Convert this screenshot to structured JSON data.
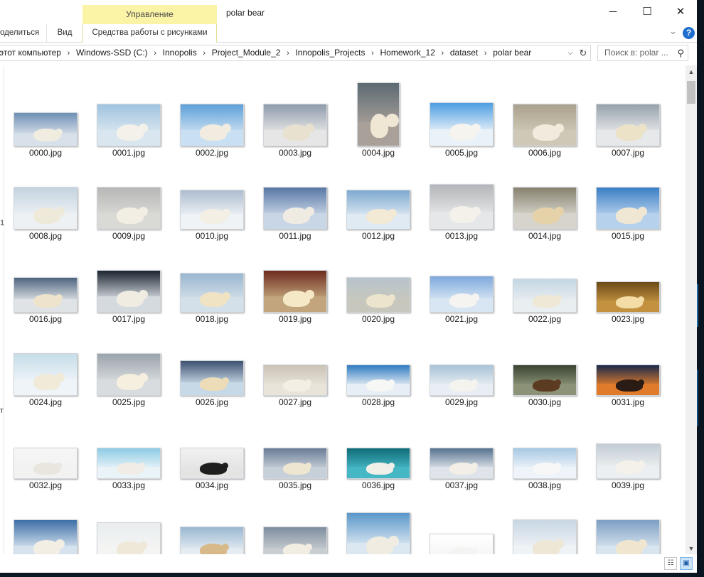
{
  "window": {
    "title": "polar bear",
    "context_tab_group": "Управление",
    "controls": {
      "minimize": "─",
      "maximize": "☐",
      "close": "✕"
    }
  },
  "ribbon": {
    "tabs": [
      {
        "label": "оделиться"
      },
      {
        "label": "Вид"
      },
      {
        "label": "Средства работы с рисунками"
      }
    ],
    "collapse_glyph": "⌄",
    "help_glyph": "?"
  },
  "address": {
    "crumbs": [
      "этот компьютер",
      "Windows-SSD (C:)",
      "Innopolis",
      "Project_Module_2",
      "Innopolis_Projects",
      "Homework_12",
      "dataset",
      "polar bear"
    ],
    "separator": "›",
    "dropdown_glyph": "⌵",
    "refresh_glyph": "↻"
  },
  "search": {
    "placeholder": "Поиск в: polar ...",
    "icon": "search-icon",
    "glyph": "⚲"
  },
  "nav_fragments": [
    "1",
    "т"
  ],
  "files": [
    {
      "name": "0000.jpg",
      "palette": [
        "#6f8fb4",
        "#d8e1ea",
        "#f1ece0"
      ]
    },
    {
      "name": "0001.jpg",
      "palette": [
        "#9fc3df",
        "#d9e6ef",
        "#f4f1ea"
      ]
    },
    {
      "name": "0002.jpg",
      "palette": [
        "#5ea0d8",
        "#c9dff2",
        "#f2ece0"
      ]
    },
    {
      "name": "0003.jpg",
      "palette": [
        "#8e9bab",
        "#e6e6e6",
        "#e8e1d0"
      ]
    },
    {
      "name": "0004.jpg",
      "palette": [
        "#5c6a72",
        "#a9a09a",
        "#efe6d4"
      ]
    },
    {
      "name": "0005.jpg",
      "palette": [
        "#4d9ee2",
        "#e9f2f9",
        "#f6f4ee"
      ]
    },
    {
      "name": "0006.jpg",
      "palette": [
        "#a9a18d",
        "#cfc8b6",
        "#f1ebdd"
      ]
    },
    {
      "name": "0007.jpg",
      "palette": [
        "#97a1ab",
        "#e6e8ea",
        "#ece2c8"
      ]
    },
    {
      "name": "0008.jpg",
      "palette": [
        "#c4d3e0",
        "#edf1f4",
        "#efe9da"
      ]
    },
    {
      "name": "0009.jpg",
      "palette": [
        "#b7b7b5",
        "#d9d9d6",
        "#f2eee4"
      ]
    },
    {
      "name": "0010.jpg",
      "palette": [
        "#aebdd0",
        "#eff3f6",
        "#f3efe4"
      ]
    },
    {
      "name": "0011.jpg",
      "palette": [
        "#5877a6",
        "#c9d6e6",
        "#efebe2"
      ]
    },
    {
      "name": "0012.jpg",
      "palette": [
        "#7ea9cf",
        "#dfeaf3",
        "#f3ead5"
      ]
    },
    {
      "name": "0013.jpg",
      "palette": [
        "#b3b5b8",
        "#e6e7e8",
        "#f4f1ea"
      ]
    },
    {
      "name": "0014.jpg",
      "palette": [
        "#87816d",
        "#d6d4cc",
        "#e6d2a8"
      ]
    },
    {
      "name": "0015.jpg",
      "palette": [
        "#3a7ec6",
        "#b5d1ec",
        "#efe7d4"
      ]
    },
    {
      "name": "0016.jpg",
      "palette": [
        "#4f6580",
        "#dfe3e6",
        "#eee4cc"
      ]
    },
    {
      "name": "0017.jpg",
      "palette": [
        "#1b2430",
        "#d5dadf",
        "#f0ece2"
      ]
    },
    {
      "name": "0018.jpg",
      "palette": [
        "#9ab6cf",
        "#d3dfe9",
        "#efe3c3"
      ]
    },
    {
      "name": "0019.jpg",
      "palette": [
        "#6d2b1f",
        "#c2a57c",
        "#f4e8c6"
      ]
    },
    {
      "name": "0020.jpg",
      "palette": [
        "#b7c4cb",
        "#c8c7bd",
        "#ece4cc"
      ]
    },
    {
      "name": "0021.jpg",
      "palette": [
        "#7ea9dc",
        "#d8e6f4",
        "#f5f4f0"
      ]
    },
    {
      "name": "0022.jpg",
      "palette": [
        "#c4d6e4",
        "#e9eef1",
        "#f0e8d6"
      ]
    },
    {
      "name": "0023.jpg",
      "palette": [
        "#6c4a16",
        "#c29240",
        "#f3dca6"
      ]
    },
    {
      "name": "0024.jpg",
      "palette": [
        "#c7dde9",
        "#eef4f8",
        "#f1ead8"
      ]
    },
    {
      "name": "0025.jpg",
      "palette": [
        "#9aa3ab",
        "#d9dcdf",
        "#f4efdf"
      ]
    },
    {
      "name": "0026.jpg",
      "palette": [
        "#3e5272",
        "#c7d8e6",
        "#ecdcb8"
      ]
    },
    {
      "name": "0027.jpg",
      "palette": [
        "#c9c2b5",
        "#e9e4da",
        "#f4efe5"
      ]
    },
    {
      "name": "0028.jpg",
      "palette": [
        "#2f7bc2",
        "#e7eef5",
        "#f7f7f5"
      ]
    },
    {
      "name": "0029.jpg",
      "palette": [
        "#a9c2d6",
        "#e8eef3",
        "#f5f3ee"
      ]
    },
    {
      "name": "0030.jpg",
      "palette": [
        "#394431",
        "#8b9277",
        "#5b3b22"
      ]
    },
    {
      "name": "0031.jpg",
      "palette": [
        "#1b2a4a",
        "#e07b2b",
        "#2a1c14"
      ]
    },
    {
      "name": "0032.jpg",
      "palette": [
        "#f6f6f6",
        "#f2f2f2",
        "#e9e6df"
      ]
    },
    {
      "name": "0033.jpg",
      "palette": [
        "#8ecbe5",
        "#e9f3f8",
        "#f1ede6"
      ]
    },
    {
      "name": "0034.jpg",
      "palette": [
        "#f1f1f1",
        "#e4e4e4",
        "#1f1f1f"
      ]
    },
    {
      "name": "0035.jpg",
      "palette": [
        "#6a7d96",
        "#c7cfd8",
        "#efe6d2"
      ]
    },
    {
      "name": "0036.jpg",
      "palette": [
        "#0f6b78",
        "#46b7c4",
        "#f0efe8"
      ]
    },
    {
      "name": "0037.jpg",
      "palette": [
        "#55728f",
        "#dfe4ea",
        "#f3efe6"
      ]
    },
    {
      "name": "0038.jpg",
      "palette": [
        "#a7c8e4",
        "#eef4f9",
        "#f7f7f7"
      ]
    },
    {
      "name": "0039.jpg",
      "palette": [
        "#c3ccd4",
        "#eceff1",
        "#f4f1ea"
      ]
    },
    {
      "name": "",
      "palette": [
        "#3d6fa7",
        "#d6e3ef",
        "#f2eee4"
      ]
    },
    {
      "name": "",
      "palette": [
        "#e9edf0",
        "#f4f4f3",
        "#efe8d8"
      ]
    },
    {
      "name": "",
      "palette": [
        "#9ab7d1",
        "#e5edf3",
        "#d8b98a"
      ]
    },
    {
      "name": "",
      "palette": [
        "#7e8e9f",
        "#c9ced2",
        "#f2ede2"
      ]
    },
    {
      "name": "",
      "palette": [
        "#5a96c9",
        "#dbe8f2",
        "#f1ece1"
      ]
    },
    {
      "name": "",
      "palette": [
        "#ffffff",
        "#f7f7f7",
        "#f4f4f2"
      ]
    },
    {
      "name": "",
      "palette": [
        "#c8d6e3",
        "#eff3f6",
        "#efe7d6"
      ]
    },
    {
      "name": "",
      "palette": [
        "#7d9fc4",
        "#d8e4ee",
        "#f0e6cf"
      ]
    }
  ],
  "statusbar": {
    "details_view_glyph": "☷",
    "tiles_view_glyph": "▣"
  },
  "colors": {
    "accent": "#1f6fce",
    "context_tab": "#fbf3a6",
    "desktop": "#081420"
  }
}
